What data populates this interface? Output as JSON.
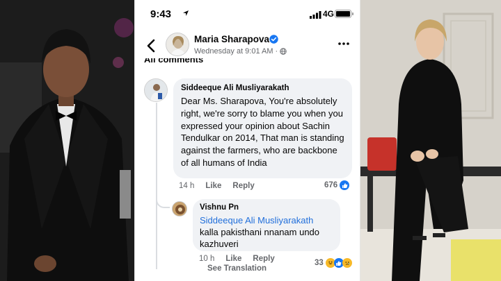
{
  "statusbar": {
    "time": "9:43",
    "network": "4G"
  },
  "post": {
    "author": "Maria Sharapova",
    "timestamp": "Wednesday at 9:01 AM",
    "privacy_icon": "globe-icon"
  },
  "comments_header": "All comments",
  "comment1": {
    "author": "Siddeeque Ali Musliyarakath",
    "text": "Dear Ms. Sharapova, You're absolutely right, we're sorry to blame you when you expressed your opinion about Sachin Tendulkar on 2014, That man is standing against the farmers, who are backbone of all humans of India",
    "time_ago": "14 h",
    "like_label": "Like",
    "reply_label": "Reply",
    "reaction_count": "676"
  },
  "comment2": {
    "author": "Vishnu Pn",
    "tag": "Siddeeque Ali Musliyarakath",
    "text": "kalla pakisthani nnanam undo kazhuveri",
    "time_ago": "10 h",
    "like_label": "Like",
    "reply_label": "Reply",
    "see_translation": "See Translation",
    "reaction_count": "33"
  },
  "colors": {
    "link_blue": "#216fdb",
    "facebook_blue": "#1877f2",
    "bubble_bg": "#f0f2f5",
    "muted_text": "#65676b"
  }
}
